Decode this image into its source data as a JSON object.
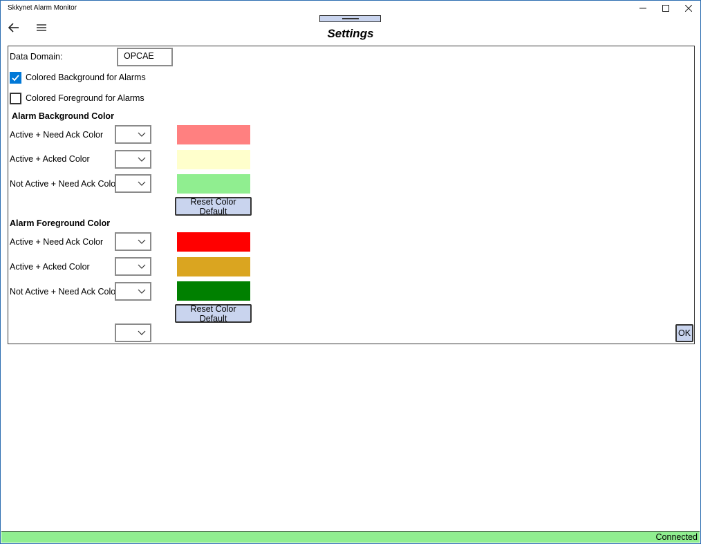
{
  "window": {
    "title": "Skkynet Alarm Monitor",
    "minimize_icon": "minimize-icon",
    "maximize_icon": "maximize-icon",
    "close_icon": "close-icon"
  },
  "nav": {
    "back_icon": "back-arrow-icon",
    "menu_icon": "hamburger-menu-icon"
  },
  "page": {
    "title": "Settings"
  },
  "settings": {
    "data_domain_label": "Data Domain:",
    "data_domain_value": "OPCAE",
    "colored_background": {
      "label": "Colored Background for Alarms",
      "checked": true
    },
    "colored_foreground": {
      "label": "Colored Foreground for Alarms",
      "checked": false
    },
    "background_section": {
      "title": "Alarm Background Color",
      "rows": [
        {
          "label": "Active + Need Ack Color",
          "color": "#ff8080"
        },
        {
          "label": "Active + Acked Color",
          "color": "#ffffcc"
        },
        {
          "label": "Not Active + Need Ack Color",
          "color": "#90ee90"
        }
      ],
      "reset_label": "Reset Color Default"
    },
    "foreground_section": {
      "title": "Alarm Foreground Color",
      "rows": [
        {
          "label": "Active + Need Ack Color",
          "color": "#ff0000"
        },
        {
          "label": "Active + Acked Color",
          "color": "#daa520"
        },
        {
          "label": "Not Active + Need Ack Color",
          "color": "#008000"
        }
      ],
      "reset_label": "Reset Color Default"
    },
    "ok_label": "OK"
  },
  "status": {
    "text": "Connected",
    "color": "#90ee90"
  }
}
